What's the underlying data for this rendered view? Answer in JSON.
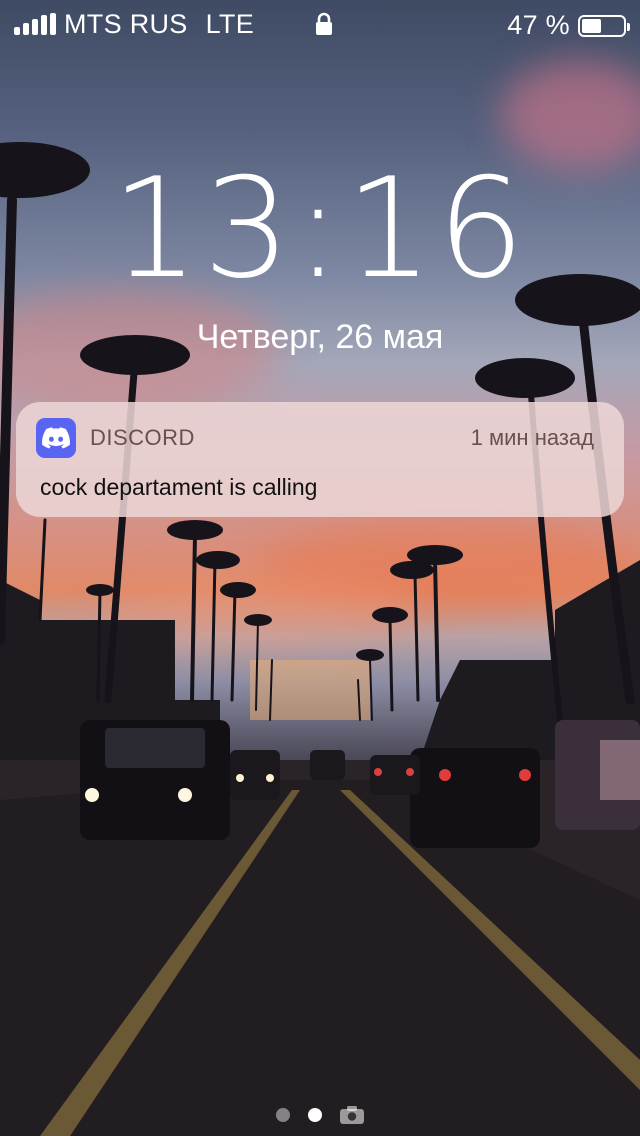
{
  "status_bar": {
    "carrier": "MTS RUS",
    "network": "LTE",
    "battery_percent_text": "47 %",
    "battery_level": 0.47
  },
  "lock_screen": {
    "time": "13:16",
    "date": "Четверг, 26 мая"
  },
  "notification": {
    "app_name": "DISCORD",
    "time_ago": "1 мин назад",
    "message": "cock departament is calling",
    "app_icon": "discord-icon",
    "accent": "#5865f2"
  },
  "page_indicator": {
    "pages": 2,
    "active_index": 1,
    "extra_icon": "camera-icon"
  }
}
